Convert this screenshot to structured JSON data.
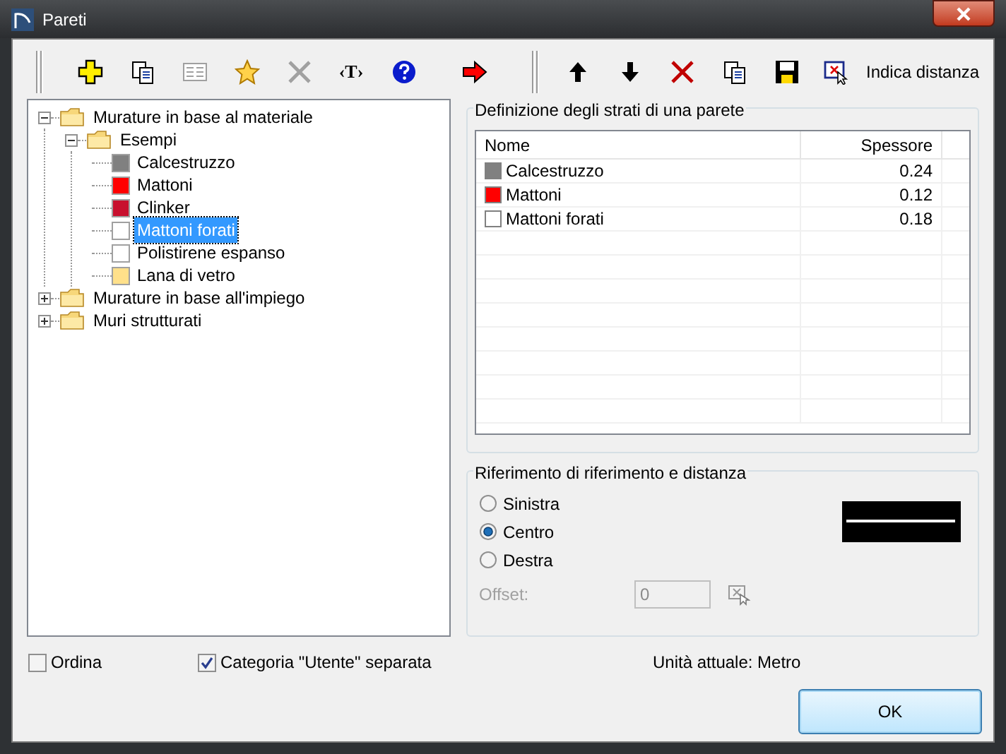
{
  "window": {
    "title": "Pareti"
  },
  "toolbar": [
    {
      "kind": "add",
      "disabled": false
    },
    {
      "kind": "copy",
      "disabled": false
    },
    {
      "kind": "properties",
      "disabled": true
    },
    {
      "kind": "favorite",
      "disabled": false
    },
    {
      "kind": "delete",
      "disabled": true
    },
    {
      "kind": "text",
      "disabled": false,
      "label": "‹T›"
    },
    {
      "kind": "help",
      "disabled": false
    },
    {
      "kind": "arrow",
      "disabled": false
    },
    {
      "kind": "separator"
    },
    {
      "kind": "up",
      "disabled": false
    },
    {
      "kind": "down",
      "disabled": false
    },
    {
      "kind": "delete",
      "disabled": false
    },
    {
      "kind": "copy",
      "disabled": false
    },
    {
      "kind": "save",
      "disabled": false
    },
    {
      "kind": "pick",
      "disabled": false,
      "label": "Indica distanza"
    }
  ],
  "tree": [
    {
      "kind": "folder",
      "label": "Murature in base al materiale",
      "expanded": true,
      "selected": false,
      "children": [
        {
          "kind": "folder",
          "label": "Esempi",
          "expanded": true,
          "selected": false,
          "children": [
            {
              "kind": "material",
              "label": "Calcestruzzo",
              "color": "#808080",
              "selected": false
            },
            {
              "kind": "material",
              "label": "Mattoni",
              "color": "#ff0000",
              "selected": false
            },
            {
              "kind": "material",
              "label": "Clinker",
              "color": "#c8102e",
              "selected": false
            },
            {
              "kind": "material",
              "label": "Mattoni forati",
              "color": "#ffffff",
              "selected": true
            },
            {
              "kind": "material",
              "label": "Polistirene espanso",
              "color": "#ffffff",
              "selected": false
            },
            {
              "kind": "material",
              "label": "Lana di vetro",
              "color": "#ffe08a",
              "selected": false
            }
          ]
        }
      ]
    },
    {
      "kind": "folder",
      "label": "Murature in base all'impiego",
      "expanded": false,
      "selected": false
    },
    {
      "kind": "folder",
      "label": "Muri strutturati",
      "expanded": false,
      "selected": false
    }
  ],
  "layers": {
    "title": "Definizione degli strati di una parete",
    "columns": [
      "Nome",
      "Spessore"
    ],
    "rows": [
      {
        "name": "Calcestruzzo",
        "thickness": "0.24",
        "color": "#808080"
      },
      {
        "name": "Mattoni",
        "thickness": "0.12",
        "color": "#ff0000"
      },
      {
        "name": "Mattoni forati",
        "thickness": "0.18",
        "color": "#ffffff"
      }
    ]
  },
  "reference": {
    "title": "Riferimento di riferimento e distanza",
    "options": [
      {
        "label": "Sinistra",
        "selected": false
      },
      {
        "label": "Centro",
        "selected": true
      },
      {
        "label": "Destra",
        "selected": false
      }
    ],
    "offset": {
      "label": "Offset:",
      "value": "0",
      "disabled": true
    }
  },
  "checkboxes": [
    {
      "label": "Ordina",
      "checked": false
    },
    {
      "label": "Categoria \"Utente\" separata",
      "checked": true
    }
  ],
  "unit": "Unità attuale: Metro",
  "ok": "OK"
}
